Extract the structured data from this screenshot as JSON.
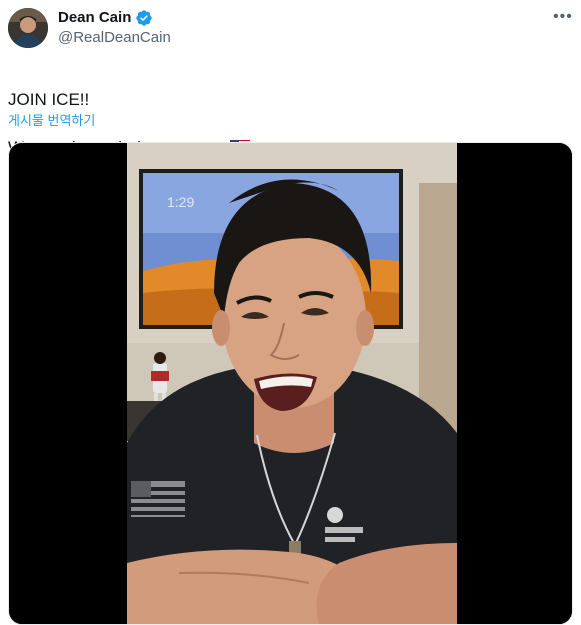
{
  "author": {
    "display_name": "Dean Cain",
    "handle": "@RealDeanCain",
    "verified": true,
    "avatar_icon": "profile-photo"
  },
  "tweet": {
    "line1": "JOIN ICE!!",
    "line2": "We need your help to protect",
    "flag_icon": "us-flag-emoji"
  },
  "translate_label": "게시물 번역하기",
  "more_icon": "more-horizontal-icon",
  "media": {
    "type": "video",
    "tv_clock": "1:29"
  },
  "colors": {
    "verified_blue": "#1d9bf0",
    "link_blue": "#1d9bf0",
    "secondary_text": "#536471"
  }
}
